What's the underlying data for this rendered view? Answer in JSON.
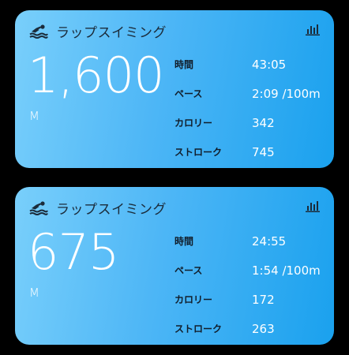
{
  "cards": [
    {
      "title": "ラップスイミング",
      "distance": "1,600",
      "unit": "M",
      "stats": [
        {
          "label": "時間",
          "value": "43:05"
        },
        {
          "label": "ペース",
          "value": "2:09 /100m"
        },
        {
          "label": "カロリー",
          "value": "342"
        },
        {
          "label": "ストローク",
          "value": "745"
        }
      ]
    },
    {
      "title": "ラップスイミング",
      "distance": "675",
      "unit": "M",
      "stats": [
        {
          "label": "時間",
          "value": "24:55"
        },
        {
          "label": "ペース",
          "value": "1:54 /100m"
        },
        {
          "label": "カロリー",
          "value": "172"
        },
        {
          "label": "ストローク",
          "value": "263"
        }
      ]
    }
  ],
  "colors": {
    "card_gradient_start": "#79cffb",
    "card_gradient_end": "#1aa1ee",
    "title_text": "#1b2b3a",
    "label_text": "#111d2a",
    "value_text": "#ffffff",
    "background": "#000000"
  },
  "icons": {
    "activity": "swimmer-icon",
    "details": "bar-chart-icon"
  }
}
